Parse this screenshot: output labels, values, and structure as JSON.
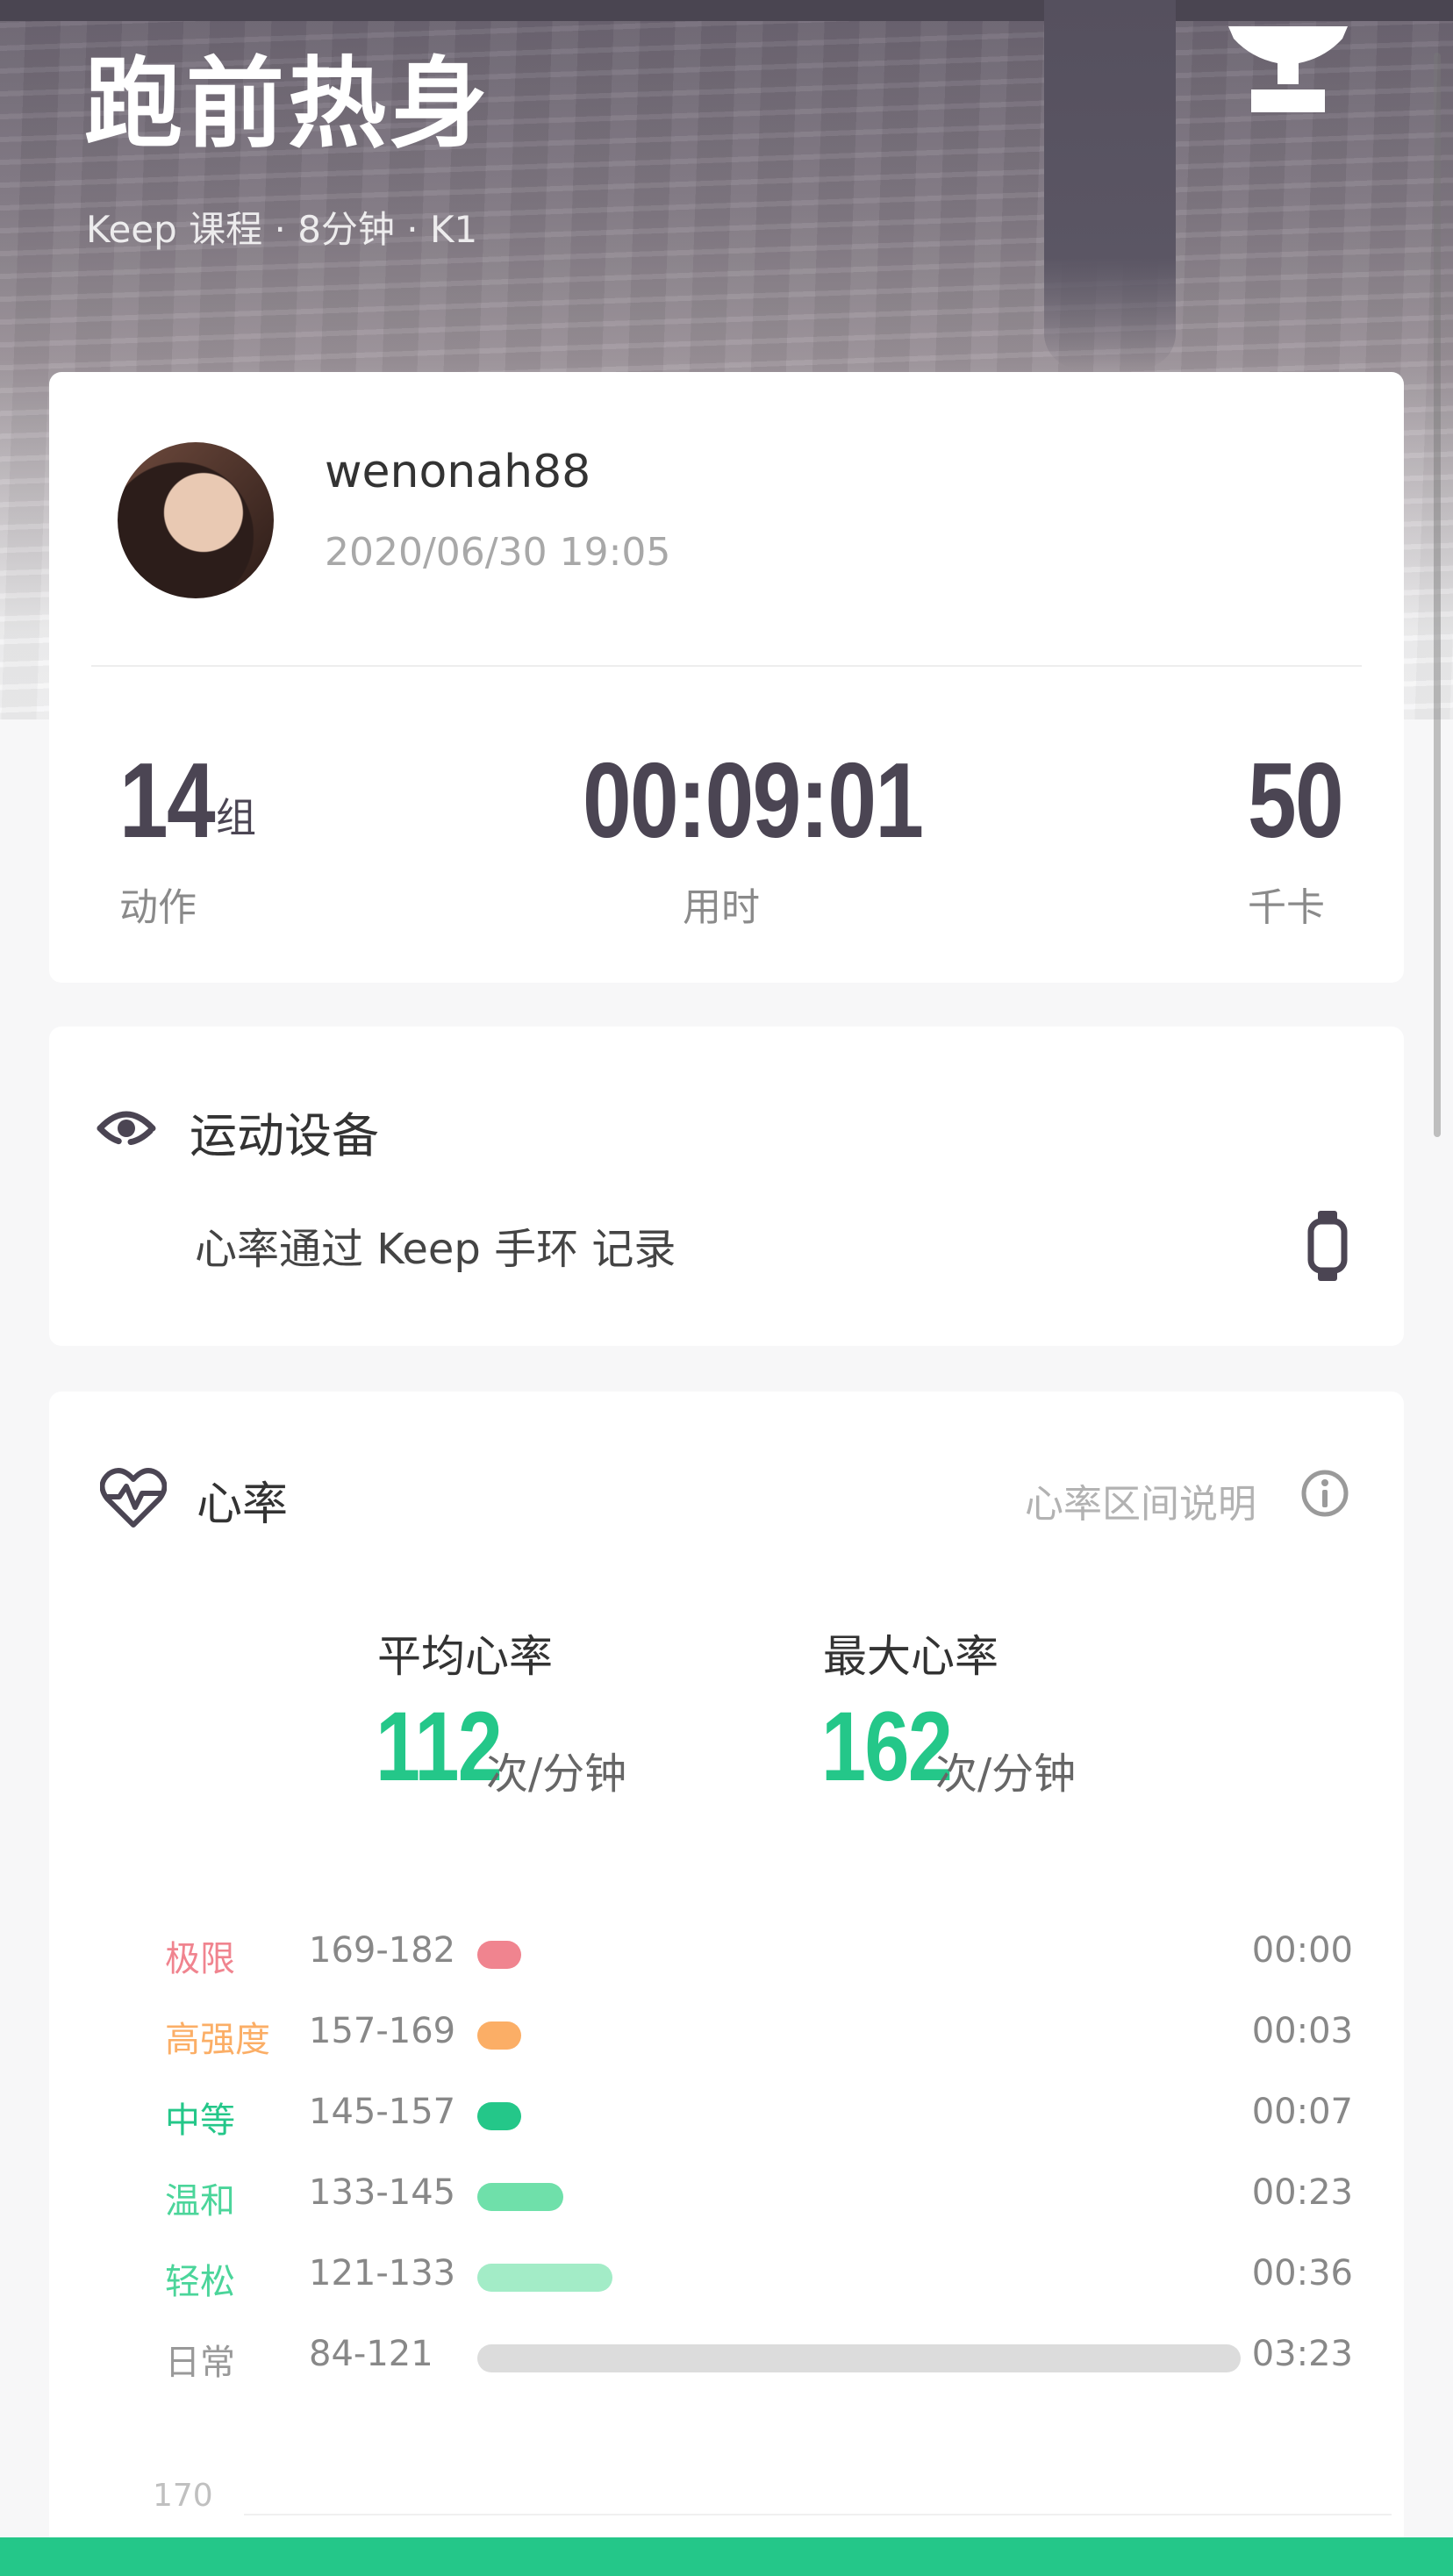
{
  "header": {
    "title": "跑前热身",
    "subtitle": "Keep 课程 · 8分钟 · K1",
    "trophy_icon": "trophy-icon"
  },
  "user": {
    "username": "wenonah88",
    "datetime": "2020/06/30 19:05"
  },
  "stats": [
    {
      "value": "14",
      "unit": "组",
      "label": "动作"
    },
    {
      "value": "00:09:01",
      "unit": "",
      "label": "用时"
    },
    {
      "value": "50",
      "unit": "",
      "label": "千卡"
    }
  ],
  "device": {
    "title": "运动设备",
    "text": "心率通过 Keep 手环 记录",
    "icon": "sport-device-icon",
    "watch_icon": "watch-icon"
  },
  "heart_rate": {
    "title": "心率",
    "zone_help": "心率区间说明",
    "avg_label": "平均心率",
    "avg_value": "112",
    "max_label": "最大心率",
    "max_value": "162",
    "unit": "次/分钟",
    "zones": [
      {
        "name": "极限",
        "range": "169-182",
        "time": "00:00",
        "fraction": 0.0,
        "color": "#f0848f",
        "name_color": "#f0848f"
      },
      {
        "name": "高强度",
        "range": "157-169",
        "time": "00:03",
        "fraction": 0.015,
        "color": "#fbae66",
        "name_color": "#fbae66"
      },
      {
        "name": "中等",
        "range": "145-157",
        "time": "00:07",
        "fraction": 0.035,
        "color": "#24c789",
        "name_color": "#24c789"
      },
      {
        "name": "温和",
        "range": "133-145",
        "time": "00:23",
        "fraction": 0.113,
        "color": "#6fe0aa",
        "name_color": "#4bd59a"
      },
      {
        "name": "轻松",
        "range": "121-133",
        "time": "00:36",
        "fraction": 0.177,
        "color": "#a3ecc7",
        "name_color": "#4bd59a"
      },
      {
        "name": "日常",
        "range": "84-121",
        "time": "03:23",
        "fraction": 1.0,
        "color": "#dcdcdc",
        "name_color": "#999999"
      }
    ],
    "chart_axis_top": "170"
  },
  "colors": {
    "accent": "#24c789",
    "stat_text": "#4b4553"
  }
}
